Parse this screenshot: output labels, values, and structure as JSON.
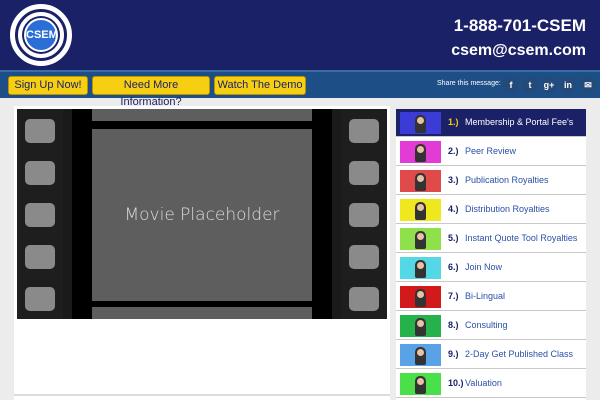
{
  "header": {
    "logo_text": "CSEM",
    "logo_ring_text": "CENTER FOR SELF EMPLOYMENT MANAGEMENT",
    "phone": "1-888-701-CSEM",
    "email": "csem@csem.com"
  },
  "nav": {
    "buttons": [
      "Sign Up Now!",
      "Need More Information?",
      "Watch The Demo"
    ],
    "share_label": "Share this message:",
    "social_icons": [
      {
        "name": "facebook-icon",
        "glyph": "f"
      },
      {
        "name": "twitter-icon",
        "glyph": "t"
      },
      {
        "name": "google-plus-icon",
        "glyph": "g+"
      },
      {
        "name": "linkedin-icon",
        "glyph": "in"
      },
      {
        "name": "email-icon",
        "glyph": "✉"
      }
    ]
  },
  "player": {
    "placeholder_text": "Movie Placeholder"
  },
  "playlist": {
    "items": [
      {
        "number": "1.)",
        "label": "Membership & Portal Fee's",
        "thumb_color": "#3b3bd6",
        "active": true
      },
      {
        "number": "2.)",
        "label": "Peer Review",
        "thumb_color": "#e23bd6",
        "active": false
      },
      {
        "number": "3.)",
        "label": "Publication Royalties",
        "thumb_color": "#e04a4a",
        "active": false
      },
      {
        "number": "4.)",
        "label": "Distribution Royalties",
        "thumb_color": "#f0e81e",
        "active": false
      },
      {
        "number": "5.)",
        "label": "Instant Quote Tool Royalties",
        "thumb_color": "#8fe04a",
        "active": false
      },
      {
        "number": "6.)",
        "label": "Join Now",
        "thumb_color": "#55d8e6",
        "active": false
      },
      {
        "number": "7.)",
        "label": "Bi-Lingual",
        "thumb_color": "#d31a1a",
        "active": false
      },
      {
        "number": "8.)",
        "label": "Consulting",
        "thumb_color": "#25b24a",
        "active": false
      },
      {
        "number": "9.)",
        "label": "2-Day Get Published Class",
        "thumb_color": "#5aa2e6",
        "active": false
      },
      {
        "number": "10.)",
        "label": "Valuation",
        "thumb_color": "#4ae04a",
        "active": false
      }
    ]
  }
}
